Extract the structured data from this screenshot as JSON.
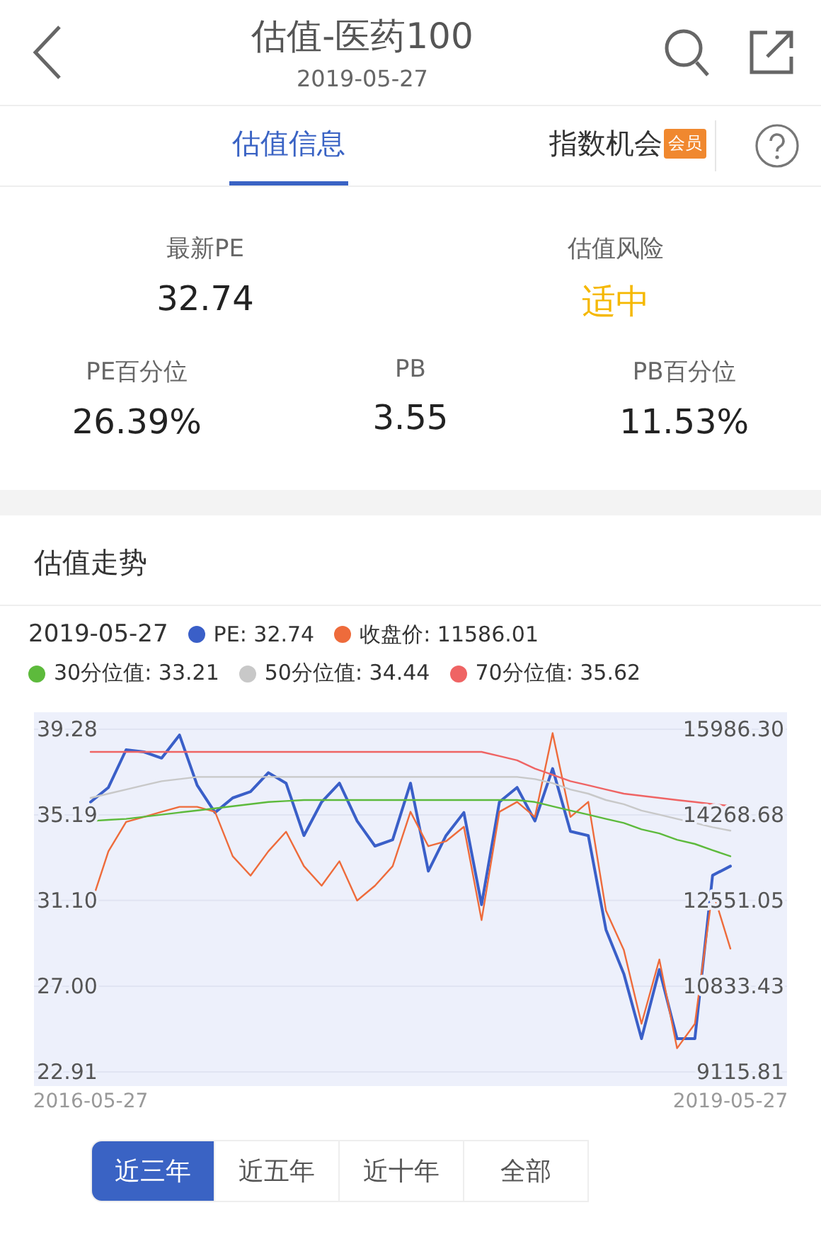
{
  "header": {
    "title": "估值-医药100",
    "subtitle": "2019-05-27"
  },
  "tabs": [
    {
      "label": "估值信息",
      "selected": true
    },
    {
      "label": "指数机会",
      "badge": "会员",
      "selected": false
    }
  ],
  "summary": {
    "top": [
      {
        "label": "最新PE",
        "value": "32.74",
        "kind": "plain"
      },
      {
        "label": "估值风险",
        "value": "适中",
        "kind": "moderate"
      }
    ],
    "bottom": [
      {
        "label": "PE百分位",
        "value": "26.39%"
      },
      {
        "label": "PB",
        "value": "3.55"
      },
      {
        "label": "PB百分位",
        "value": "11.53%"
      }
    ]
  },
  "trend": {
    "title": "估值走势",
    "legend_date": "2019-05-27",
    "legend": [
      {
        "reading": ": 32.74"
      },
      {
        "reading": ": 11586.01"
      },
      {
        "reading": ": 33.21"
      },
      {
        "reading": ": 34.44"
      },
      {
        "reading": ": 35.62"
      }
    ],
    "chart_data": {
      "type": "line",
      "grid": true,
      "categories": [
        "2016-05-27",
        null,
        null,
        null,
        null,
        null,
        null,
        null,
        null,
        null,
        null,
        null,
        null,
        null,
        null,
        null,
        null,
        null,
        null,
        null,
        null,
        null,
        null,
        null,
        null,
        null,
        null,
        null,
        null,
        null,
        null,
        null,
        null,
        null,
        null,
        null,
        "2019-05-27"
      ],
      "ylim": [
        22.91,
        39.28
      ],
      "yticks": [
        {
          "value": 39.28,
          "label": "39.28"
        },
        {
          "value": 35.19,
          "label": "35.19"
        },
        {
          "value": 31.1,
          "label": "31.10"
        },
        {
          "value": 27.0,
          "label": "27.00"
        },
        {
          "value": 22.91,
          "label": "22.91"
        }
      ],
      "y2lim": [
        9115.81,
        15986.3
      ],
      "y2ticks": [
        {
          "value": 15986.3,
          "label": "15986.30"
        },
        {
          "value": 14268.68,
          "label": "14268.68"
        },
        {
          "value": 12551.05,
          "label": "12551.05"
        },
        {
          "value": 10833.43,
          "label": "10833.43"
        },
        {
          "value": 9115.81,
          "label": "9115.81"
        }
      ],
      "series": [
        {
          "name": "PE",
          "color": "#3a5fc8",
          "values": [
            35.8,
            36.5,
            38.3,
            38.2,
            37.9,
            39.0,
            36.6,
            35.3,
            36.0,
            36.3,
            37.2,
            36.7,
            34.2,
            35.8,
            36.7,
            34.9,
            33.7,
            34.0,
            36.7,
            32.5,
            34.2,
            35.3,
            30.9,
            35.8,
            36.5,
            34.9,
            37.4,
            34.4,
            34.2,
            29.7,
            27.6,
            24.5,
            27.8,
            24.5,
            24.5,
            32.3,
            32.74
          ]
        },
        {
          "name": "收盘价",
          "color": "#ee6b3b",
          "axis": "y2",
          "values": [
            12450,
            13540,
            14130,
            14230,
            14330,
            14430,
            14430,
            14330,
            13440,
            13050,
            13540,
            13930,
            13240,
            12850,
            13340,
            12550,
            12850,
            13240,
            14330,
            13640,
            13740,
            14030,
            12160,
            14330,
            14530,
            14230,
            15910,
            14230,
            14530,
            12350,
            11560,
            10080,
            11370,
            9590,
            10080,
            12750,
            11590
          ]
        },
        {
          "name": "30分位值",
          "color": "#5dba3c",
          "values": [
            34.9,
            34.95,
            35.0,
            35.1,
            35.2,
            35.3,
            35.4,
            35.5,
            35.6,
            35.7,
            35.8,
            35.85,
            35.9,
            35.9,
            35.9,
            35.9,
            35.9,
            35.9,
            35.9,
            35.9,
            35.9,
            35.9,
            35.9,
            35.9,
            35.9,
            35.8,
            35.6,
            35.4,
            35.2,
            35.0,
            34.8,
            34.5,
            34.3,
            34.0,
            33.8,
            33.5,
            33.21
          ]
        },
        {
          "name": "50分位值",
          "color": "#c8c8c8",
          "values": [
            36.0,
            36.2,
            36.4,
            36.6,
            36.8,
            36.9,
            37.0,
            37.0,
            37.0,
            37.0,
            37.0,
            37.0,
            37.0,
            37.0,
            37.0,
            37.0,
            37.0,
            37.0,
            37.0,
            37.0,
            37.0,
            37.0,
            37.0,
            37.0,
            37.0,
            36.9,
            36.7,
            36.4,
            36.2,
            35.9,
            35.7,
            35.4,
            35.2,
            35.0,
            34.8,
            34.6,
            34.44
          ]
        },
        {
          "name": "70分位值",
          "color": "#ef6464",
          "values": [
            38.2,
            38.2,
            38.2,
            38.2,
            38.2,
            38.2,
            38.2,
            38.2,
            38.2,
            38.2,
            38.2,
            38.2,
            38.2,
            38.2,
            38.2,
            38.2,
            38.2,
            38.2,
            38.2,
            38.2,
            38.2,
            38.2,
            38.2,
            38.0,
            37.8,
            37.4,
            37.1,
            36.8,
            36.6,
            36.4,
            36.2,
            36.1,
            36.0,
            35.9,
            35.8,
            35.7,
            35.62
          ]
        }
      ]
    },
    "range_buttons": [
      {
        "label": "近三年",
        "selected": true
      },
      {
        "label": "近五年",
        "selected": false
      },
      {
        "label": "近十年",
        "selected": false
      },
      {
        "label": "全部",
        "selected": false
      }
    ]
  }
}
